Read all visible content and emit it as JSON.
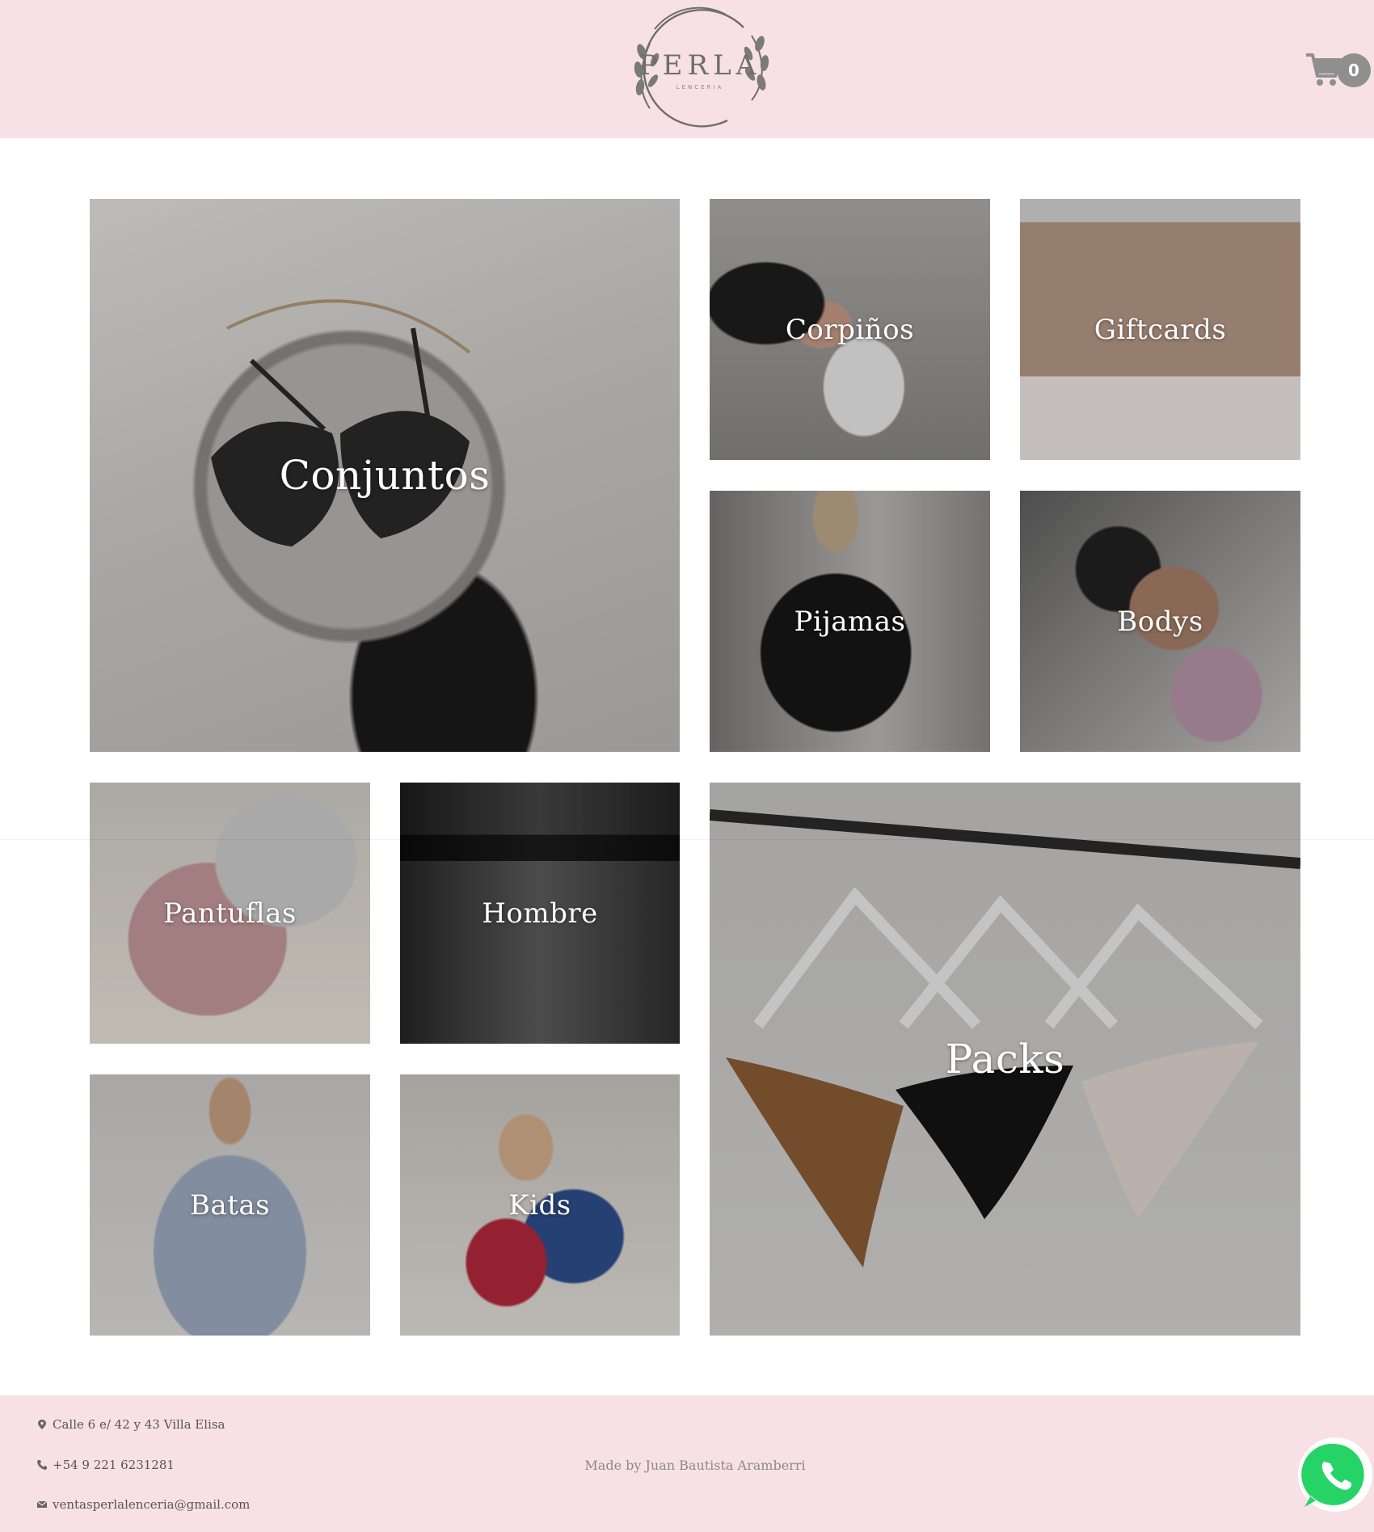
{
  "header": {
    "logo": {
      "name": "PERLA",
      "tagline": "LENCERIA"
    },
    "cart": {
      "icon": "cart-icon",
      "count": "0"
    }
  },
  "categories": [
    {
      "label": "Conjuntos"
    },
    {
      "label": "Corpiños"
    },
    {
      "label": "Giftcards"
    },
    {
      "label": "Pijamas"
    },
    {
      "label": "Bodys"
    },
    {
      "label": "Pantuflas"
    },
    {
      "label": "Hombre"
    },
    {
      "label": "Packs"
    },
    {
      "label": "Batas"
    },
    {
      "label": "Kids"
    }
  ],
  "footer": {
    "address": "Calle 6 e/ 42 y 43 Villa Elisa",
    "phone": "+54 9 221 6231281",
    "email": "ventasperlalenceria@gmail.com",
    "credit": "Made by Juan Bautista Aramberri",
    "icons": [
      "map-pin-icon",
      "phone-icon",
      "envelope-icon",
      "whatsapp-icon"
    ]
  },
  "colors": {
    "brand_pink": "#f7e1e6",
    "cart_badge": "#8f8f8f",
    "whatsapp_green": "#25d366"
  }
}
